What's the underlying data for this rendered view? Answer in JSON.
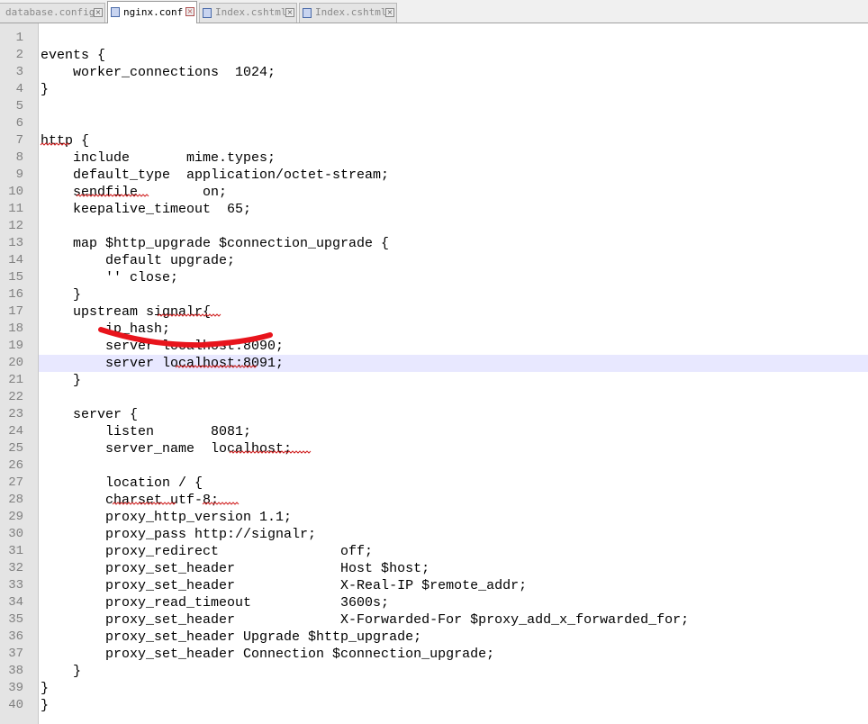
{
  "tabs": [
    {
      "label": "database.config",
      "active": false
    },
    {
      "label": "nginx.conf",
      "active": true
    },
    {
      "label": "Index.cshtml",
      "active": false
    },
    {
      "label": "Index.cshtml",
      "active": false
    }
  ],
  "editor": {
    "highlighted_line": 20,
    "lines": [
      {
        "n": "1",
        "text": ""
      },
      {
        "n": "2",
        "text": "events {"
      },
      {
        "n": "3",
        "text": "    worker_connections  1024;"
      },
      {
        "n": "4",
        "text": "}"
      },
      {
        "n": "5",
        "text": ""
      },
      {
        "n": "6",
        "text": ""
      },
      {
        "n": "7",
        "text": "http {"
      },
      {
        "n": "8",
        "text": "    include       mime.types;"
      },
      {
        "n": "9",
        "text": "    default_type  application/octet-stream;"
      },
      {
        "n": "10",
        "text": "    sendfile        on;"
      },
      {
        "n": "11",
        "text": "    keepalive_timeout  65;"
      },
      {
        "n": "12",
        "text": ""
      },
      {
        "n": "13",
        "text": "    map $http_upgrade $connection_upgrade {"
      },
      {
        "n": "14",
        "text": "        default upgrade;"
      },
      {
        "n": "15",
        "text": "        '' close;"
      },
      {
        "n": "16",
        "text": "    }"
      },
      {
        "n": "17",
        "text": "    upstream signalr{"
      },
      {
        "n": "18",
        "text": "        ip_hash;"
      },
      {
        "n": "19",
        "text": "        server localhost:8090;"
      },
      {
        "n": "20",
        "text": "        server localhost:8091;"
      },
      {
        "n": "21",
        "text": "    }"
      },
      {
        "n": "22",
        "text": ""
      },
      {
        "n": "23",
        "text": "    server {"
      },
      {
        "n": "24",
        "text": "        listen       8081;"
      },
      {
        "n": "25",
        "text": "        server_name  localhost;"
      },
      {
        "n": "26",
        "text": ""
      },
      {
        "n": "27",
        "text": "        location / {"
      },
      {
        "n": "28",
        "text": "        charset utf-8;"
      },
      {
        "n": "29",
        "text": "        proxy_http_version 1.1;"
      },
      {
        "n": "30",
        "text": "        proxy_pass http://signalr;"
      },
      {
        "n": "31",
        "text": "        proxy_redirect               off;"
      },
      {
        "n": "32",
        "text": "        proxy_set_header             Host $host;"
      },
      {
        "n": "33",
        "text": "        proxy_set_header             X-Real-IP $remote_addr;"
      },
      {
        "n": "34",
        "text": "        proxy_read_timeout           3600s;"
      },
      {
        "n": "35",
        "text": "        proxy_set_header             X-Forwarded-For $proxy_add_x_forwarded_for;"
      },
      {
        "n": "36",
        "text": "        proxy_set_header Upgrade $http_upgrade;"
      },
      {
        "n": "37",
        "text": "        proxy_set_header Connection $connection_upgrade;"
      },
      {
        "n": "38",
        "text": "    }"
      },
      {
        "n": "39",
        "text": "}"
      },
      {
        "n": "40",
        "text": "}"
      }
    ]
  },
  "colors": {
    "highlight": "#e8e8ff",
    "annotation_stroke": "#e8141c",
    "spellcheck_squiggle": "#d02020"
  },
  "icons": {
    "tab_file": "document-icon",
    "tab_close": "close-icon"
  },
  "glyphs": {
    "close": "×"
  }
}
